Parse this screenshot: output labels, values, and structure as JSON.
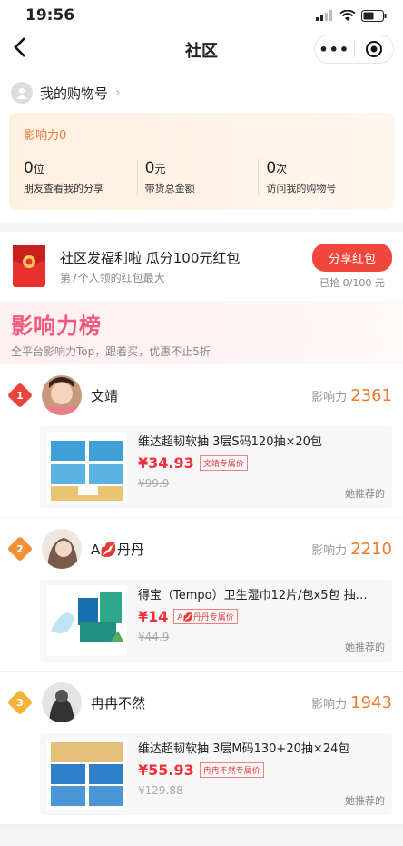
{
  "status": {
    "time": "19:56"
  },
  "nav": {
    "title": "社区",
    "more_icon": "more-dots-icon",
    "capsule_target_icon": "target-icon"
  },
  "account": {
    "label": "我的购物号"
  },
  "influence": {
    "title": "影响力0",
    "stats": [
      {
        "value": "0",
        "unit": "位",
        "label": "朋友查看我的分享"
      },
      {
        "value": "0",
        "unit": "元",
        "label": "带货总金额"
      },
      {
        "value": "0",
        "unit": "次",
        "label": "访问我的购物号"
      }
    ]
  },
  "redpacket": {
    "title": "社区发福利啦 瓜分100元红包",
    "subtitle": "第7个人领的红包最大",
    "button": "分享红包",
    "progress": "已抢 0/100 元"
  },
  "ranking": {
    "title": "影响力榜",
    "subtitle": "全平台影响力Top，跟着买，优惠不止5折",
    "influence_label": "影响力",
    "recommend_label": "她推荐的",
    "entries": [
      {
        "rank": "1",
        "name": "文靖",
        "score": "2361",
        "product": {
          "title": "维达超韧软抽 3层S码120抽×20包",
          "price": "¥34.93",
          "tag": "文靖专属价",
          "original": "¥99.9"
        },
        "medal_color": "#e8453c"
      },
      {
        "rank": "2",
        "name": "A💋丹丹",
        "score": "2210",
        "product": {
          "title": "得宝（Tempo）卫生湿巾12片/包x5包 抽…",
          "price": "¥14",
          "tag": "A💋丹丹专属价",
          "original": "¥44.9"
        },
        "medal_color": "#f0913a"
      },
      {
        "rank": "3",
        "name": "冉冉不然",
        "score": "1943",
        "product": {
          "title": "维达超韧软抽 3层M码130+20抽×24包",
          "price": "¥55.93",
          "tag": "冉冉不然专属价",
          "original": "¥129.88"
        },
        "medal_color": "#f2b33a"
      }
    ]
  }
}
